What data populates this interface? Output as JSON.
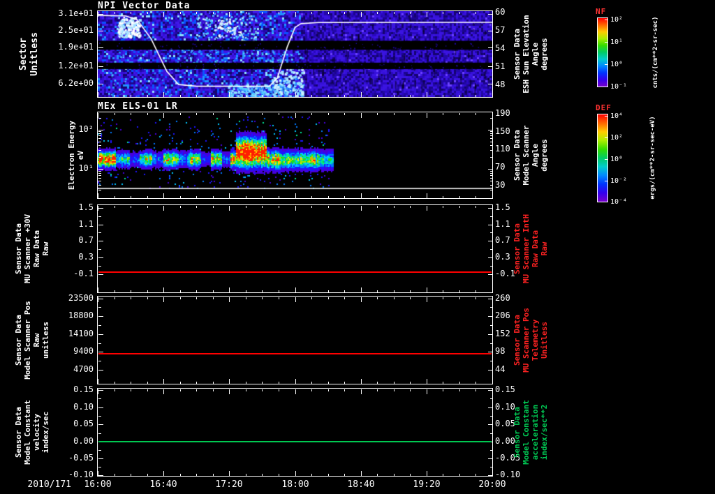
{
  "x_axis": {
    "date_label": "2010/171",
    "tick_labels": [
      "16:00",
      "16:40",
      "17:20",
      "18:00",
      "18:40",
      "19:20",
      "20:00"
    ]
  },
  "colorbars": [
    {
      "name": "NF",
      "unit": "cnts/(cm**2-sr-sec)",
      "tick_labels": [
        "10²",
        "10¹",
        "10⁰",
        "10⁻¹"
      ],
      "tick_fracs": [
        0.03,
        0.35,
        0.67,
        0.99
      ]
    },
    {
      "name": "DEF",
      "unit": "ergs/(cm**2-sr-sec-eV)",
      "tick_labels": [
        "10⁴",
        "10²",
        "10⁰",
        "10⁻²",
        "10⁻⁴"
      ],
      "tick_fracs": [
        0.02,
        0.265,
        0.51,
        0.755,
        0.995
      ]
    }
  ],
  "chart_data": [
    {
      "type": "heatmap",
      "title": "NPI Vector Data",
      "ylabel": "Sector\nUnitless",
      "yticks": [
        {
          "label": "3.1e+01",
          "frac": 0.03
        },
        {
          "label": "2.5e+01",
          "frac": 0.225
        },
        {
          "label": "1.9e+01",
          "frac": 0.425
        },
        {
          "label": "1.2e+01",
          "frac": 0.64
        },
        {
          "label": "6.2e+00",
          "frac": 0.845
        }
      ],
      "right_label": "Sensor Data\nESH Sun Elevation\nAngle\ndegrees",
      "right_label_color": "#ffffff",
      "right_ticks": [
        {
          "label": "60",
          "frac": 0.02
        },
        {
          "label": "57",
          "frac": 0.23
        },
        {
          "label": "54",
          "frac": 0.44
        },
        {
          "label": "51",
          "frac": 0.65
        },
        {
          "label": "48",
          "frac": 0.86
        }
      ],
      "colorbar": "NF",
      "x_range": [
        "16:00",
        "20:00"
      ],
      "overlay_line": {
        "name": "sun-elevation",
        "color": "#ffffff",
        "points_frac": [
          [
            0,
            0.05
          ],
          [
            0.07,
            0.055
          ],
          [
            0.1,
            0.1
          ],
          [
            0.135,
            0.32
          ],
          [
            0.175,
            0.7
          ],
          [
            0.205,
            0.855
          ],
          [
            0.25,
            0.875
          ],
          [
            0.435,
            0.875
          ],
          [
            0.455,
            0.78
          ],
          [
            0.48,
            0.42
          ],
          [
            0.5,
            0.19
          ],
          [
            0.515,
            0.145
          ],
          [
            0.56,
            0.132
          ],
          [
            1,
            0.13
          ]
        ]
      },
      "black_band_fracs": [
        [
          0.345,
          0.45
        ],
        [
          0.6,
          0.675
        ]
      ]
    },
    {
      "type": "heatmap",
      "title": "MEx ELS-01 LR",
      "ylabel": "Electron Energy\neV",
      "yticks": [
        {
          "label": "10²",
          "frac": 0.2
        },
        {
          "label": "10¹",
          "frac": 0.66
        }
      ],
      "right_label": "Sensor Data\nModel Scanner\nAngle\ndegrees",
      "right_label_color": "#ffffff",
      "right_ticks": [
        {
          "label": "190",
          "frac": 0.02
        },
        {
          "label": "150",
          "frac": 0.225
        },
        {
          "label": "110",
          "frac": 0.43
        },
        {
          "label": "70",
          "frac": 0.64
        },
        {
          "label": "30",
          "frac": 0.85
        }
      ],
      "colorbar": "DEF",
      "data_end_frac": 0.595,
      "overlay_line": {
        "name": "model-scanner-angle",
        "color": "#ffffff",
        "points_frac": [
          [
            0,
            0.888
          ],
          [
            1,
            0.888
          ]
        ]
      }
    },
    {
      "type": "line",
      "ylabel": "Sensor Data\nMU Scanner +30V\nRaw Data\nRaw",
      "yticks": [
        {
          "label": "1.5",
          "frac": 0.03
        },
        {
          "label": "1.1",
          "frac": 0.22
        },
        {
          "label": "0.7",
          "frac": 0.41
        },
        {
          "label": "0.3",
          "frac": 0.6
        },
        {
          "label": "-0.1",
          "frac": 0.79
        }
      ],
      "right_label": "Sensor Data\nMU Scanner IntH\nRaw Data\nRaw",
      "right_label_color": "#ff2222",
      "right_ticks": [
        {
          "label": "1.5",
          "frac": 0.03
        },
        {
          "label": "1.1",
          "frac": 0.22
        },
        {
          "label": "0.7",
          "frac": 0.41
        },
        {
          "label": "0.3",
          "frac": 0.6
        },
        {
          "label": "-0.1",
          "frac": 0.79
        }
      ],
      "line": {
        "color": "#ff0000",
        "value_frac": 0.765,
        "approx_value": "-0.05"
      }
    },
    {
      "type": "line",
      "ylabel": "Sensor Data\nModel Scanner Pos\nRaw\nunitless",
      "yticks": [
        {
          "label": "23500",
          "frac": 0.02
        },
        {
          "label": "18800",
          "frac": 0.225
        },
        {
          "label": "14100",
          "frac": 0.43
        },
        {
          "label": "9400",
          "frac": 0.635
        },
        {
          "label": "4700",
          "frac": 0.84
        }
      ],
      "right_label": "Sensor Data\nMU Scanner Pos\nTelemetry\nUnitless",
      "right_label_color": "#ff2222",
      "right_ticks": [
        {
          "label": "260",
          "frac": 0.02
        },
        {
          "label": "206",
          "frac": 0.225
        },
        {
          "label": "152",
          "frac": 0.43
        },
        {
          "label": "98",
          "frac": 0.635
        },
        {
          "label": "44",
          "frac": 0.84
        }
      ],
      "line": {
        "color": "#ff0000",
        "value_frac": 0.655,
        "approx_value": "8800"
      }
    },
    {
      "type": "line",
      "ylabel": "Sensor Data\nModel Constant\nvelocity\nindex/sec",
      "yticks": [
        {
          "label": "0.15",
          "frac": 0.016
        },
        {
          "label": "0.10",
          "frac": 0.213
        },
        {
          "label": "0.05",
          "frac": 0.41
        },
        {
          "label": "0.00",
          "frac": 0.606
        },
        {
          "label": "-0.05",
          "frac": 0.803
        },
        {
          "label": "-0.10",
          "frac": 0.995
        }
      ],
      "right_label": "Sensor Data\nModel Constant\nacceleration\nindex/sec**2",
      "right_label_color": "#00cc55",
      "right_ticks": [
        {
          "label": "0.15",
          "frac": 0.016
        },
        {
          "label": "0.10",
          "frac": 0.213
        },
        {
          "label": "0.05",
          "frac": 0.41
        },
        {
          "label": "0.00",
          "frac": 0.606
        },
        {
          "label": "-0.05",
          "frac": 0.803
        },
        {
          "label": "-0.10",
          "frac": 0.995
        }
      ],
      "line": {
        "color": "#00c850",
        "value_frac": 0.606,
        "approx_value": "0.00"
      }
    }
  ]
}
